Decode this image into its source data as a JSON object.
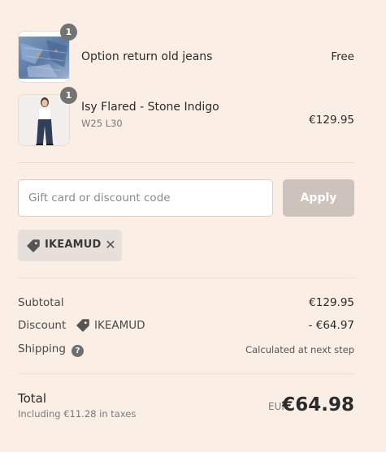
{
  "line_items": [
    {
      "name": "Option return old jeans",
      "variant": "",
      "price": "Free",
      "quantity": "1",
      "thumbnail": "denim-fabric-image"
    },
    {
      "name": "Isy Flared - Stone Indigo",
      "variant": "W25 L30",
      "price": "€129.95",
      "quantity": "1",
      "thumbnail": "model-wearing-flared-jeans-image"
    }
  ],
  "discount_form": {
    "placeholder": "Gift card or discount code",
    "value": "",
    "apply_label": "Apply"
  },
  "applied_code": {
    "code": "IKEAMUD",
    "icon": "tag-icon",
    "remove_icon": "close-icon",
    "remove_symbol": "✕"
  },
  "summary": {
    "subtotal_label": "Subtotal",
    "subtotal_value": "€129.95",
    "discount_label": "Discount",
    "discount_code": "IKEAMUD",
    "discount_value": "- €64.97",
    "shipping_label": "Shipping",
    "shipping_help_icon": "question-icon",
    "shipping_help_symbol": "?",
    "shipping_value": "Calculated at next step"
  },
  "total": {
    "label": "Total",
    "tax_note": "Including €11.28 in taxes",
    "currency": "EUR",
    "amount": "€64.98"
  },
  "colors": {
    "background": "#fbeee5",
    "apply_button": "#cdc3bc",
    "chip_background": "#e7dfd9",
    "badge": "#737373"
  }
}
